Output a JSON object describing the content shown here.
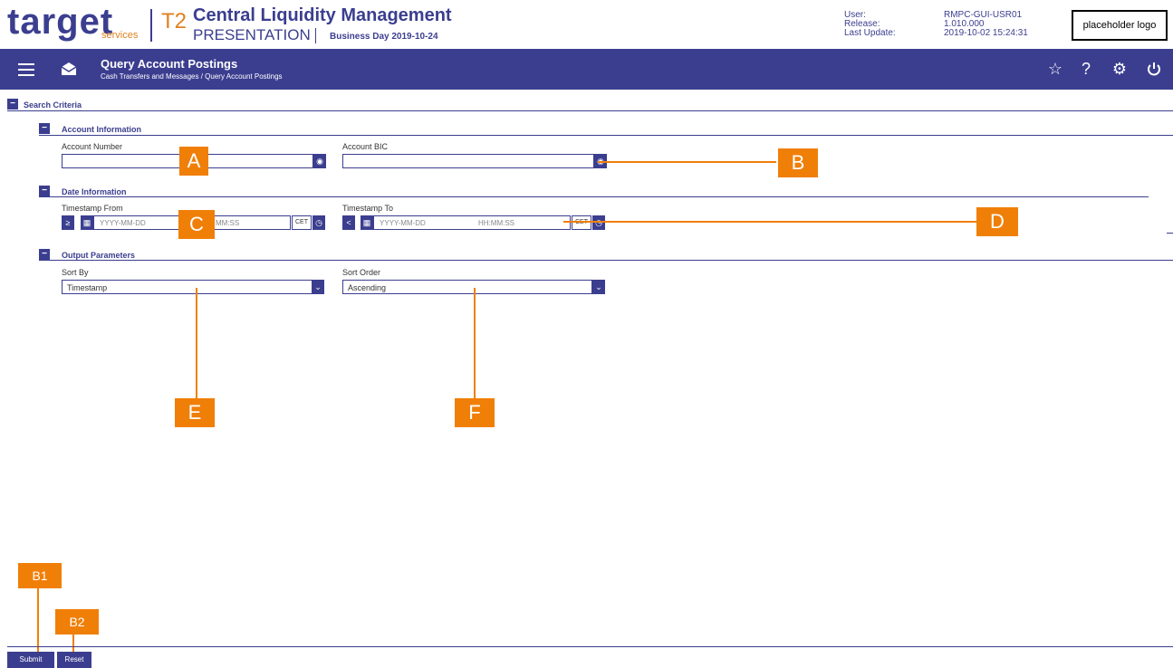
{
  "header": {
    "brand": "target",
    "brand_sub": "services",
    "t2": "T2",
    "app_title": "Central Liquidity Management",
    "app_sub": "PRESENTATION",
    "business_day": "Business Day 2019-10-24",
    "meta_labels": [
      "User:",
      "Release:",
      "Last Update:"
    ],
    "meta_values": [
      "RMPC-GUI-USR01",
      "1.010.000",
      "2019-10-02 15:24:31"
    ],
    "logo_placeholder": "placeholder logo"
  },
  "navbar": {
    "title": "Query Account Postings",
    "breadcrumb": "Cash Transfers and Messages  /  Query Account Postings",
    "icons": [
      "menu-icon",
      "mail-icon",
      "star-icon",
      "help-icon",
      "settings-icon",
      "power-icon"
    ],
    "help_glyph": "?"
  },
  "search": {
    "title": "Search Criteria",
    "account_info": {
      "title": "Account Information",
      "account_number_label": "Account Number",
      "account_bic_label": "Account BIC"
    },
    "date_info": {
      "title": "Date Information",
      "from_label": "Timestamp From",
      "to_label": "Timestamp To",
      "from_op": "≥",
      "to_op": "<",
      "date_placeholder": "YYYY-MM-DD",
      "time_placeholder": "HH:MM:SS",
      "time_placeholder_partial": "MM:SS",
      "tz": "CET"
    },
    "output": {
      "title": "Output Parameters",
      "sort_by_label": "Sort By",
      "sort_by_value": "Timestamp",
      "sort_order_label": "Sort Order",
      "sort_order_value": "Ascending"
    }
  },
  "callouts": {
    "a": "A",
    "b": "B",
    "c": "C",
    "d": "D",
    "e": "E",
    "f": "F",
    "b1": "B1",
    "b2": "B2"
  },
  "footer": {
    "submit": "Submit",
    "reset": "Reset"
  },
  "colors": {
    "primary": "#3b3e8f",
    "accent": "#f07f08",
    "brand_orange": "#e0811f"
  }
}
